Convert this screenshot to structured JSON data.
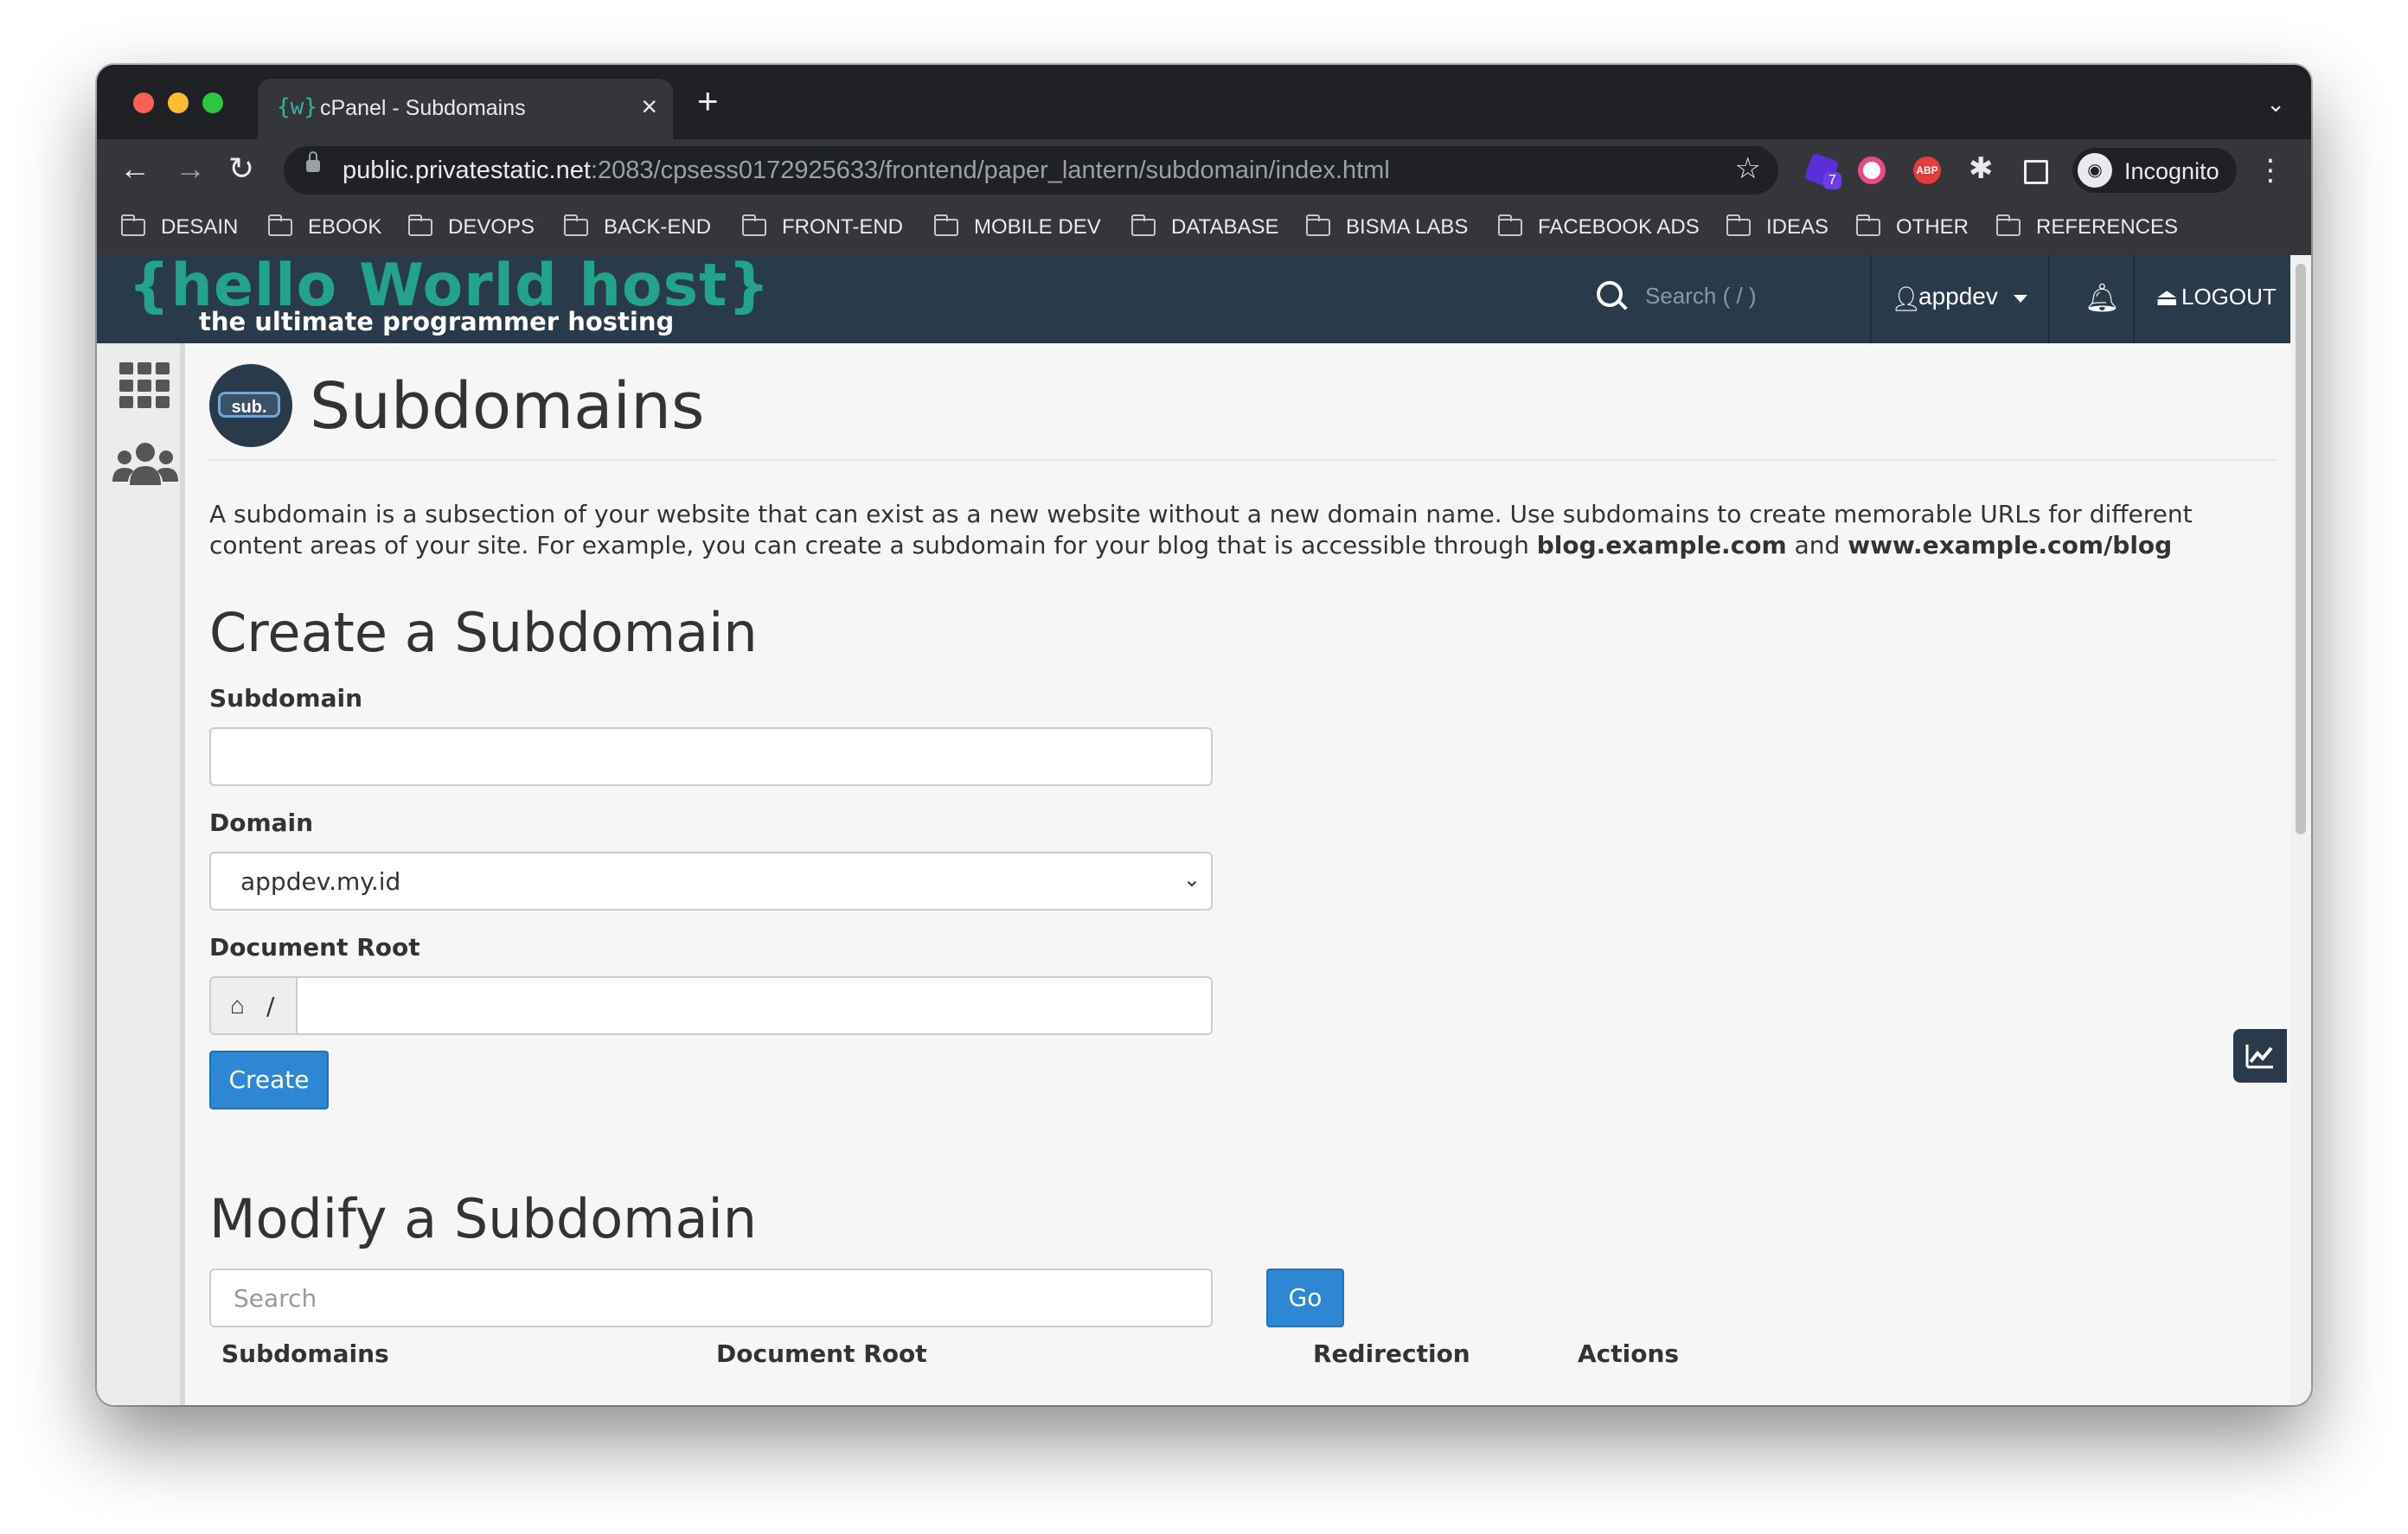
{
  "browser": {
    "tab_title": "cPanel - Subdomains",
    "tab_favicon": "{w}",
    "new_tab": "+",
    "url_host": "public.privatestatic.net",
    "url_path": ":2083/cpsess0172925633/frontend/paper_lantern/subdomain/index.html",
    "extension_badge": "7",
    "abp_label": "ABP",
    "incognito_label": "Incognito",
    "bookmarks": [
      "DESAIN",
      "EBOOK",
      "DEVOPS",
      "BACK-END",
      "FRONT-END",
      "MOBILE DEV",
      "DATABASE",
      "BISMA LABS",
      "FACEBOOK ADS",
      "IDEAS",
      "OTHER",
      "REFERENCES"
    ]
  },
  "header": {
    "logo_main": "{hello World host}",
    "logo_sub": "the ultimate programmer hosting",
    "search_placeholder": "Search ( / )",
    "username": "appdev",
    "logout": "LOGOUT"
  },
  "page": {
    "badge_text": "sub.",
    "title": "Subdomains",
    "description_part1": "A subdomain is a subsection of your website that can exist as a new website without a new domain name. Use subdomains to create memorable URLs for different content areas of your site. For example, you can create a subdomain for your blog that is accessible through ",
    "description_bold1": "blog.example.com",
    "description_mid": " and ",
    "description_bold2": "www.example.com/blog"
  },
  "create": {
    "heading": "Create a Subdomain",
    "subdomain_label": "Subdomain",
    "subdomain_value": "",
    "domain_label": "Domain",
    "domain_selected": "appdev.my.id",
    "docroot_label": "Document Root",
    "docroot_prefix": "/",
    "docroot_value": "",
    "create_button": "Create"
  },
  "modify": {
    "heading": "Modify a Subdomain",
    "search_placeholder": "Search",
    "go_button": "Go",
    "columns": [
      "Subdomains",
      "Document Root",
      "Redirection",
      "Actions"
    ]
  },
  "colors": {
    "header_bg": "#293a4a",
    "logo_green": "#23a389",
    "primary_button": "#2d87d3"
  }
}
